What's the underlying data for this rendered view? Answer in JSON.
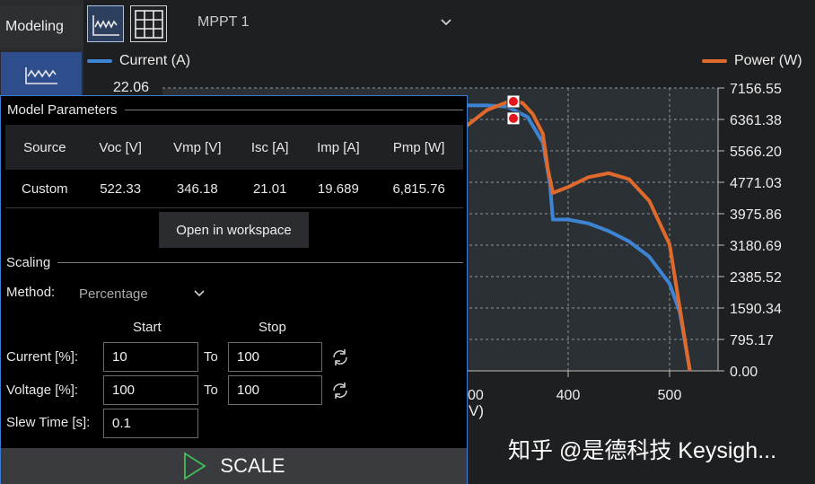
{
  "nav": {
    "modeling_label": "Modeling",
    "dropdown_value": "MPPT 1"
  },
  "chart": {
    "legend_current": "Current (A)",
    "legend_power": "Power (W)",
    "left_top_tick": "22.06",
    "right_ticks": [
      "7156.55",
      "6361.38",
      "5566.20",
      "4771.03",
      "3975.86",
      "3180.69",
      "2385.52",
      "1590.34",
      "795.17",
      "0.00"
    ],
    "x_ticks_visible": [
      "00",
      "400",
      "500"
    ],
    "x_label_fragment": "V)"
  },
  "chart_data": {
    "type": "line",
    "xlabel": "V)",
    "ylabel_left": "",
    "ylabel_right": "",
    "xlim": [
      0,
      530
    ],
    "ylim_left": [
      0,
      22.06
    ],
    "ylim_right": [
      0,
      7156.55
    ],
    "grid": true,
    "series": [
      {
        "name": "Current (A)",
        "color": "#3d84d4",
        "axis": "left",
        "x": [
          300,
          320,
          340,
          360,
          375,
          382,
          385,
          400,
          420,
          440,
          460,
          480,
          500,
          510,
          520
        ],
        "y": [
          20.7,
          20.7,
          20.6,
          19.8,
          17.8,
          14.6,
          11.8,
          11.8,
          11.5,
          10.9,
          10.1,
          8.9,
          6.8,
          4.6,
          0.0
        ]
      },
      {
        "name": "Power (W)",
        "color": "#e0692c",
        "axis": "right",
        "x": [
          300,
          320,
          340,
          346,
          355,
          365,
          375,
          380,
          385,
          400,
          420,
          440,
          460,
          480,
          500,
          510,
          520
        ],
        "y": [
          6200,
          6600,
          6800,
          6816,
          6780,
          6500,
          6000,
          5100,
          4500,
          4650,
          4900,
          5000,
          4850,
          4300,
          3200,
          1600,
          0
        ]
      }
    ],
    "markers": [
      {
        "x": 346,
        "y": 6816,
        "axis": "right"
      },
      {
        "x": 346,
        "y": 19.689,
        "axis": "left"
      }
    ]
  },
  "model_params": {
    "title": "Model Parameters",
    "headers": [
      "Source",
      "Voc [V]",
      "Vmp [V]",
      "Isc [A]",
      "Imp [A]",
      "Pmp [W]"
    ],
    "row": [
      "Custom",
      "522.33",
      "346.18",
      "21.01",
      "19.689",
      "6,815.76"
    ],
    "open_button": "Open in workspace"
  },
  "scaling": {
    "title": "Scaling",
    "method_label": "Method:",
    "method_value": "Percentage",
    "start_header": "Start",
    "stop_header": "Stop",
    "current_label": "Current [%]:",
    "current_start": "10",
    "current_stop": "100",
    "voltage_label": "Voltage [%]:",
    "voltage_start": "100",
    "voltage_stop": "100",
    "to_label": "To",
    "slew_label": "Slew Time [s]:",
    "slew_value": "0.1",
    "scale_button": "SCALE"
  },
  "watermark": "知乎 @是德科技 Keysigh..."
}
